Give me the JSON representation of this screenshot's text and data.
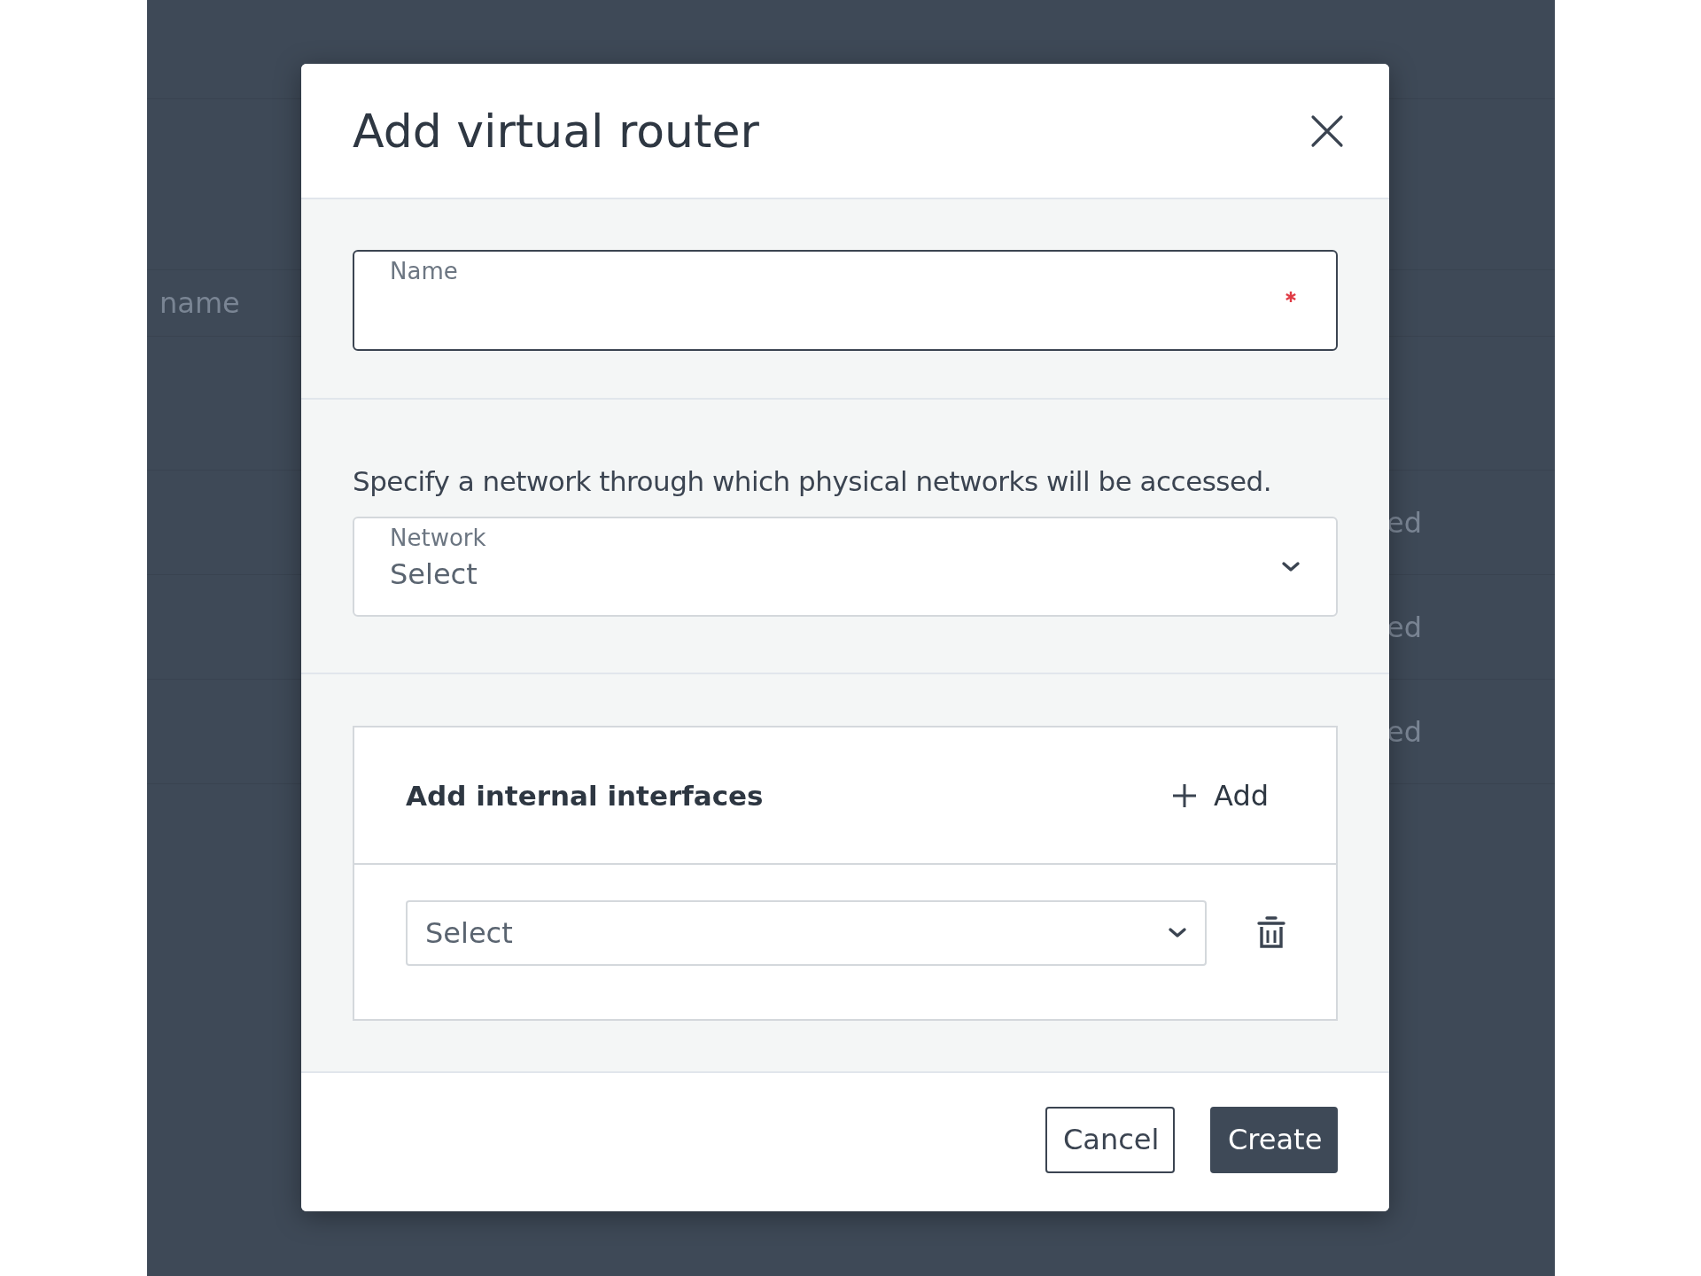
{
  "background_table": {
    "header_cell": "name",
    "rows": [
      {
        "status": "ed"
      },
      {
        "status": "ed"
      },
      {
        "status": "ed"
      }
    ]
  },
  "dialog": {
    "title": "Add virtual router",
    "name_field": {
      "label": "Name",
      "required": true
    },
    "network_hint": "Specify a network through which physical networks will be accessed.",
    "network_field": {
      "label": "Network",
      "placeholder": "Select"
    },
    "interfaces": {
      "title": "Add internal interfaces",
      "add_button": "Add",
      "rows": [
        {
          "placeholder": "Select"
        }
      ]
    },
    "buttons": [
      {
        "label": "Cancel",
        "kind": "secondary"
      },
      {
        "label": "Create",
        "kind": "primary"
      }
    ]
  }
}
